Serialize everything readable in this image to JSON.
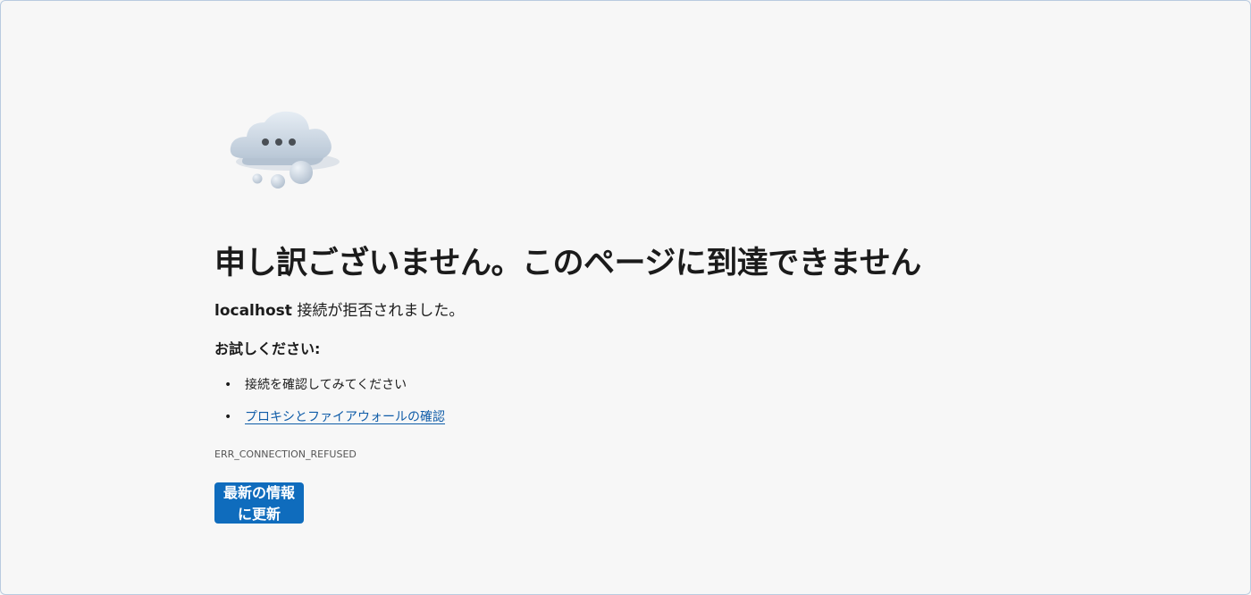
{
  "error_page": {
    "title": "申し訳ございません。このページに到達できません",
    "host": "localhost",
    "message": " 接続が拒否されました。",
    "try_heading": "お試しください:",
    "suggestions": [
      {
        "text": "接続を確認してみてください",
        "is_link": false
      },
      {
        "text": "プロキシとファイアウォールの確認",
        "is_link": true
      }
    ],
    "bullet": "•",
    "error_code": "ERR_CONNECTION_REFUSED",
    "refresh_label": "最新の情報に更新",
    "illustration_icon": "cloud-icon"
  },
  "colors": {
    "background": "#f7f7f7",
    "button": "#0f6cbd",
    "link": "#0f5ca8"
  }
}
